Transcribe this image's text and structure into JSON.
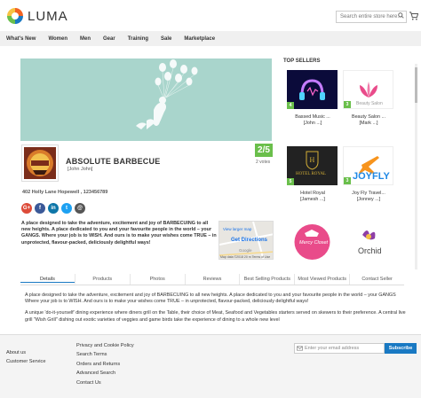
{
  "header": {
    "logo_text": "LUMA",
    "search_placeholder": "Search entire store here...",
    "search_icon": "search-icon",
    "cart_icon": "cart-icon"
  },
  "nav": [
    "What's New",
    "Women",
    "Men",
    "Gear",
    "Training",
    "Sale",
    "Marketplace"
  ],
  "store": {
    "name": "ABSOLUTE BARBECUE",
    "owner": "[John John]",
    "rating": "2/5",
    "votes": "2 votes",
    "address": "402 Holly Lane Hopewell ,   123456789",
    "about": "A place designed to take the adventure, excitement and joy of BARBECUING to all new heights. A place dedicated to you and your favourite people in the world – your GANGS. Where your job is to WISH. And ours is to make your wishes come TRUE – in unprotected, flavour-packed, deliciously delightful ways!",
    "socials": [
      "G+",
      "f",
      "in",
      "t",
      "@"
    ],
    "social_colors": [
      "#dd4b39",
      "#3b5998",
      "#0e76a8",
      "#1da1f2",
      "#555555"
    ],
    "logo_text": "ABSOLUTE BARBECUES"
  },
  "map": {
    "larger": "View larger map",
    "directions": "Get Directions",
    "google": "Google",
    "footer": "Map data ©2018   20 m   Terms of Use"
  },
  "top_sellers": {
    "title": "TOP SELLERS",
    "items": [
      {
        "name": "Bassed Music ...",
        "owner": "[John ...]",
        "rating": "4",
        "colors": "#0b0b3a"
      },
      {
        "name": "Beauty Salon ...",
        "owner": "[Mark ...]",
        "rating": "3",
        "colors": "#ffffff",
        "img_text": "Beauty Salon"
      },
      {
        "name": "Hotel Royal",
        "owner": "[Jamesh ...]",
        "rating": "5",
        "colors": "#222222",
        "img_text": "HOTEL ROYAL"
      },
      {
        "name": "Joy Fly Travel...",
        "owner": "[Jonney ...]",
        "rating": "3",
        "colors": "#ffffff",
        "img_text": "JOYFLY"
      },
      {
        "name": "",
        "owner": "",
        "rating": "",
        "colors": "#ffffff",
        "img_text": "Mercy Closet"
      },
      {
        "name": "",
        "owner": "",
        "rating": "",
        "colors": "#ffffff",
        "img_text": "Orchid"
      }
    ]
  },
  "tabs": [
    "Details",
    "Products",
    "Photos",
    "Reviews",
    "Best Selling Products",
    "Most Viewed Products",
    "Contact Seller"
  ],
  "details": {
    "p1": "A place designed to take the adventure, excitement and joy of BARBECUING to all new heights. A place dedicated to you and your favourite people in the world – your GANGS Where your job is to WISH. And ours is to make your wishes come TRUE – in unprotected, flavour-packed, deliciously delightful ways!",
    "p2": "A unique 'do-it-yourself' dining experience where diners grill on the Table, their choice of Meat, Seafood and Vegetables starters served on skewers to their preference. A central live grill \"Wish Grill\" dishing out exotic varieties of veggies and game birds take the experience of dining to a whole new level"
  },
  "footer": {
    "col1": [
      "About us",
      "Customer Service"
    ],
    "col2": [
      "Privacy and Cookie Policy",
      "Search Terms",
      "Orders and Returns",
      "Advanced Search",
      "Contact Us"
    ],
    "email_placeholder": "Enter your email address",
    "subscribe": "Subscribe"
  }
}
